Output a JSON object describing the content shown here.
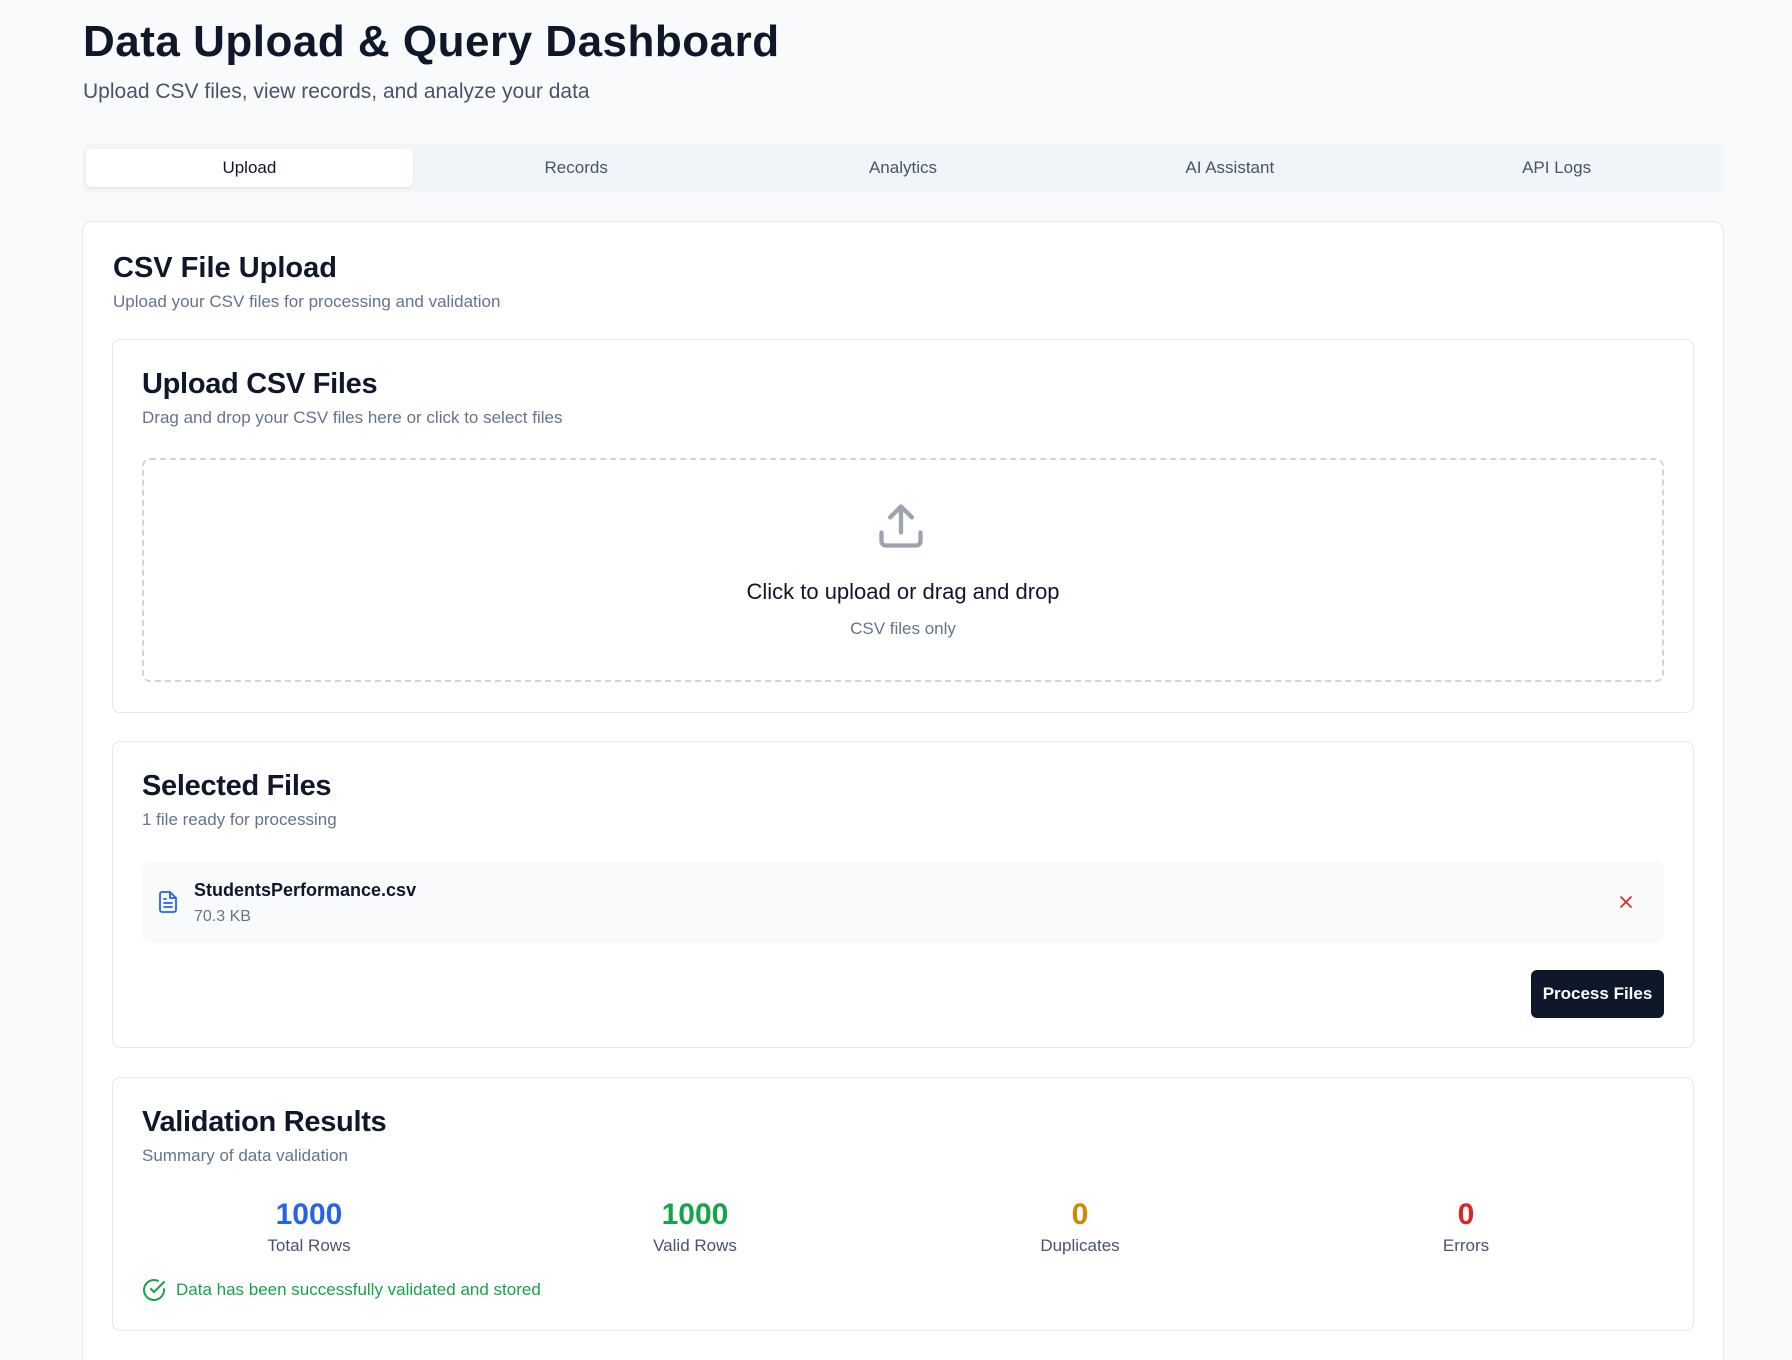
{
  "header": {
    "title": "Data Upload & Query Dashboard",
    "subtitle": "Upload CSV files, view records, and analyze your data"
  },
  "tabs": [
    {
      "label": "Upload",
      "active": true
    },
    {
      "label": "Records",
      "active": false
    },
    {
      "label": "Analytics",
      "active": false
    },
    {
      "label": "AI Assistant",
      "active": false
    },
    {
      "label": "API Logs",
      "active": false
    }
  ],
  "section": {
    "title": "CSV File Upload",
    "description": "Upload your CSV files for processing and validation"
  },
  "upload": {
    "title": "Upload CSV Files",
    "description": "Drag and drop your CSV files here or click to select files",
    "dropzone_text": "Click to upload or drag and drop",
    "dropzone_hint": "CSV files only",
    "icon": "upload-icon"
  },
  "selected_files": {
    "title": "Selected Files",
    "description": "1 file ready for processing",
    "files": [
      {
        "name": "StudentsPerformance.csv",
        "size": "70.3 KB",
        "icon": "file-text-icon"
      }
    ],
    "process_label": "Process Files"
  },
  "validation": {
    "title": "Validation Results",
    "description": "Summary of data validation",
    "stats": [
      {
        "value": "1000",
        "label": "Total Rows",
        "color": "#2563eb"
      },
      {
        "value": "1000",
        "label": "Valid Rows",
        "color": "#16a34a"
      },
      {
        "value": "0",
        "label": "Duplicates",
        "color": "#ca8a04"
      },
      {
        "value": "0",
        "label": "Errors",
        "color": "#dc2626"
      }
    ],
    "success_message": "Data has been successfully validated and stored"
  },
  "colors": {
    "primary": "#0f172a",
    "muted": "#64748b",
    "border": "#e2e8f0",
    "danger": "#dc2626",
    "success": "#16a34a",
    "file_icon": "#2563eb"
  }
}
